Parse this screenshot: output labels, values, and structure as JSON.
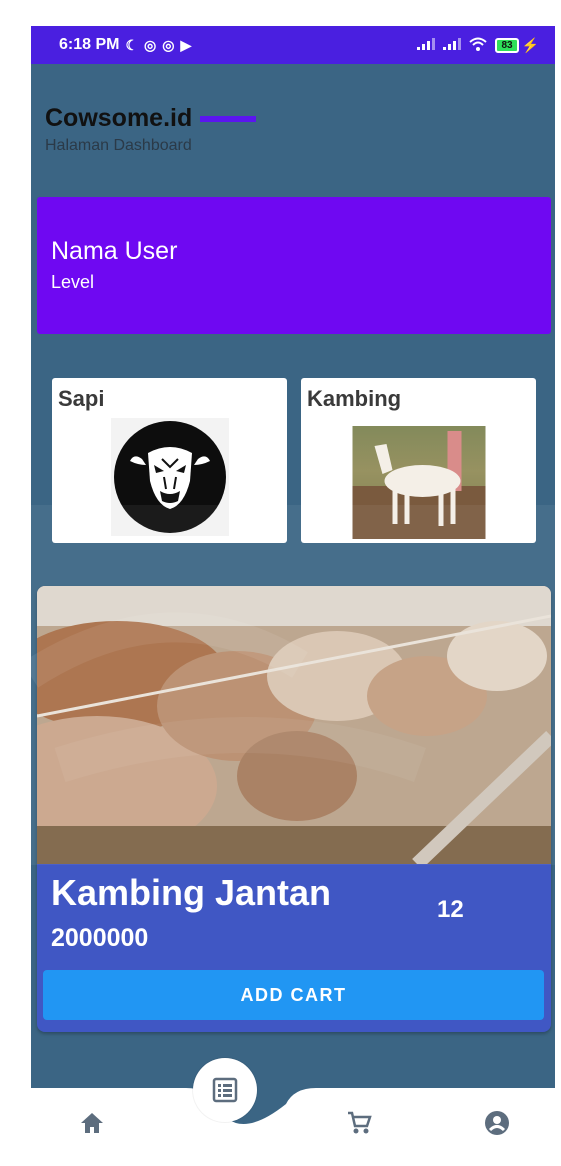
{
  "status_bar": {
    "time": "6:18 PM",
    "battery": "83"
  },
  "app": {
    "title": "Cowsome.id",
    "subtitle": "Halaman Dashboard"
  },
  "user_card": {
    "name": "Nama User",
    "level": "Level"
  },
  "categories": [
    {
      "label": "Sapi"
    },
    {
      "label": "Kambing"
    }
  ],
  "product": {
    "name": "Kambing Jantan",
    "quantity": "12",
    "price": "2000000",
    "add_cart_label": "ADD CART"
  },
  "colors": {
    "status_bar": "#4a1fe0",
    "background": "#3b6584",
    "user_card": "#6f08f2",
    "product_card": "#4057c4",
    "add_cart_button": "#2196f3",
    "nav_icon": "#5d6d7e"
  },
  "bottom_nav": {
    "items": [
      {
        "icon": "home-icon"
      },
      {
        "icon": "list-icon",
        "active": true
      },
      {
        "icon": "cart-icon"
      },
      {
        "icon": "account-icon"
      }
    ]
  }
}
